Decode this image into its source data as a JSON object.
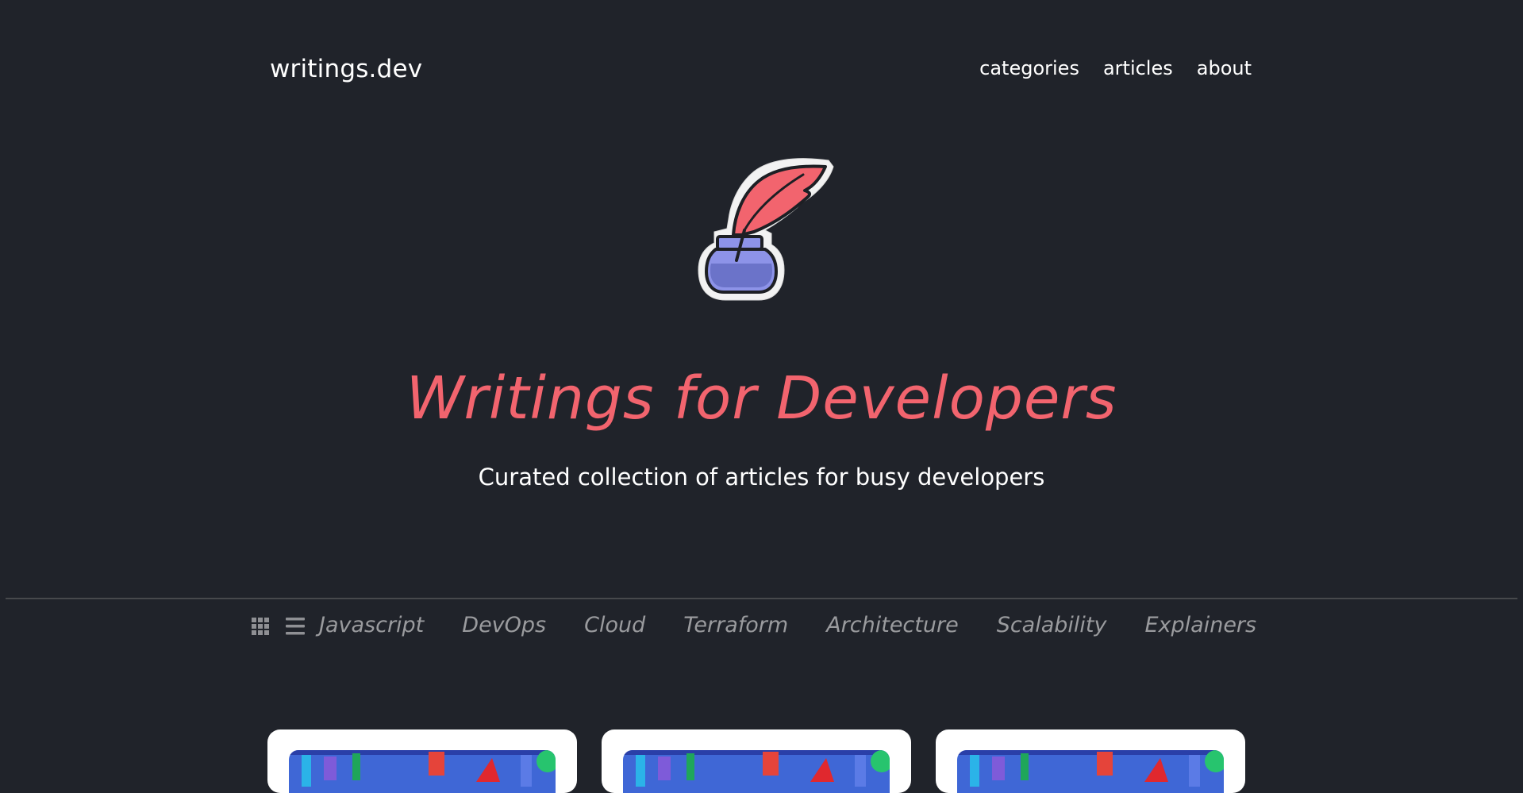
{
  "header": {
    "brand": "writings.dev",
    "nav": [
      {
        "label": "categories"
      },
      {
        "label": "articles"
      },
      {
        "label": "about"
      }
    ]
  },
  "hero": {
    "logo_icon": "quill-inkwell-icon",
    "title": "Writings for Developers",
    "subtitle": "Curated collection of articles for busy developers"
  },
  "toolbar": {
    "view_toggles": [
      {
        "icon": "grid-view-icon"
      },
      {
        "icon": "list-view-icon"
      }
    ],
    "categories": [
      {
        "label": "Javascript"
      },
      {
        "label": "DevOps"
      },
      {
        "label": "Cloud"
      },
      {
        "label": "Terraform"
      },
      {
        "label": "Architecture"
      },
      {
        "label": "Scalability"
      },
      {
        "label": "Explainers"
      }
    ]
  },
  "colors": {
    "background": "#20232a",
    "accent": "#f2646e",
    "muted_text": "#9a9b9e",
    "divider": "#47494c"
  }
}
